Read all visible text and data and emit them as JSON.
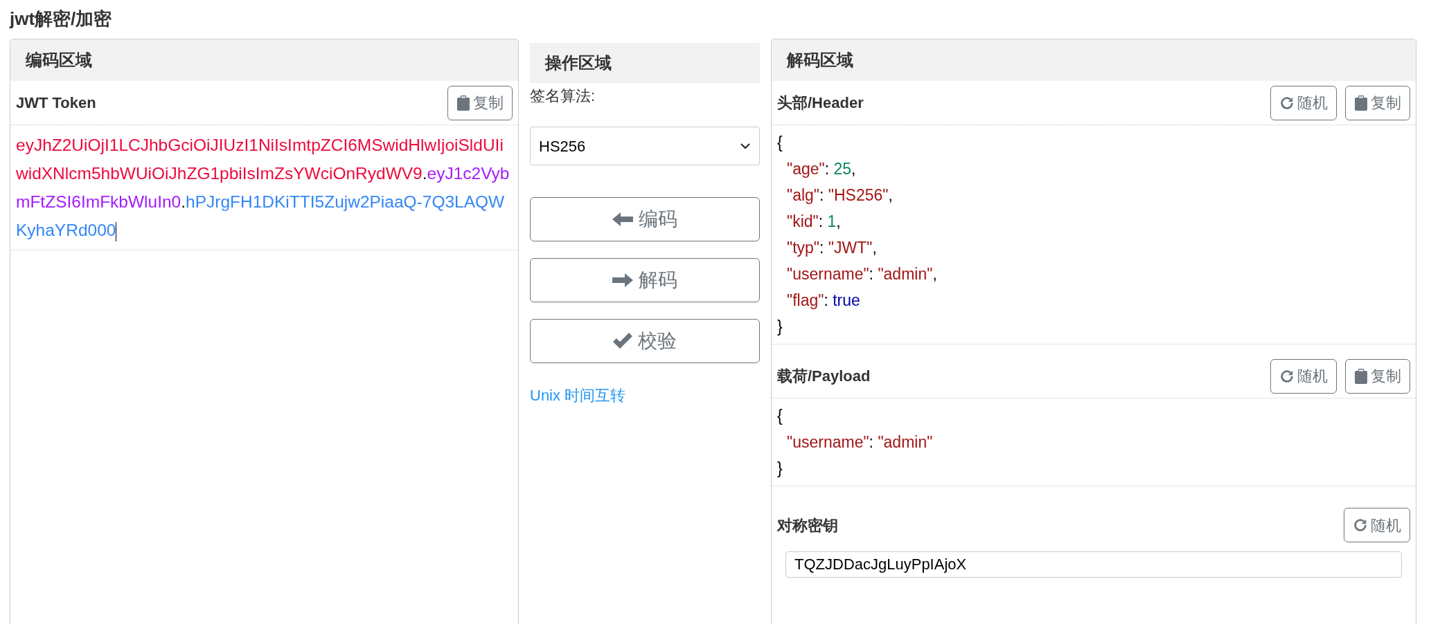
{
  "page_title": "jwt解密/加密",
  "encode_panel": {
    "title": "编码区域",
    "label": "JWT Token",
    "copy_button": "复制",
    "token_parts": [
      {
        "kind": "header",
        "text": "eyJhZ2UiOjI1LCJhbGciOiJIUzI1NiIsImtpZCI6MSwidHlwIjoiSldUIiwidXNlcm5hbWUiOiJhZG1pbiIsImZsYWciOnRydWV9",
        "color": "#ee0a3c"
      },
      {
        "kind": "dot",
        "text": "."
      },
      {
        "kind": "payload",
        "text": "eyJ1c2VybmFtZSI6ImFkbWluIn0",
        "color": "#a31aff"
      },
      {
        "kind": "dot",
        "text": "."
      },
      {
        "kind": "signature",
        "text": "hPJrgFH1DKiTTI5Zujw2PiaaQ-7Q3LAQWKyhaYRd000",
        "color": "#3287f5"
      }
    ]
  },
  "operate_panel": {
    "title": "操作区域",
    "algorithm_label": "签名算法:",
    "algorithm_value": "HS256",
    "buttons": [
      {
        "kind": "encode",
        "label": "编码"
      },
      {
        "kind": "decode",
        "label": "解码"
      },
      {
        "kind": "verify",
        "label": "校验"
      }
    ],
    "link": "Unix 时间互转"
  },
  "decode_panel": {
    "title": "解码区域",
    "header": {
      "label": "头部/Header",
      "random_button": "随机",
      "copy_button": "复制",
      "lines": [
        {
          "kind": "brace",
          "text": "{"
        },
        {
          "kind": "number",
          "key": "\"age\"",
          "colon": ":",
          "value": "25",
          "comma": ","
        },
        {
          "kind": "string",
          "key": "\"alg\"",
          "colon": ":",
          "value": "\"HS256\"",
          "comma": ","
        },
        {
          "kind": "number",
          "key": "\"kid\"",
          "colon": ":",
          "value": "1",
          "comma": ","
        },
        {
          "kind": "string",
          "key": "\"typ\"",
          "colon": ":",
          "value": "\"JWT\"",
          "comma": ","
        },
        {
          "kind": "string",
          "key": "\"username\"",
          "colon": ":",
          "value": "\"admin\"",
          "comma": ","
        },
        {
          "kind": "boolean",
          "key": "\"flag\"",
          "colon": ":",
          "value": "true"
        },
        {
          "kind": "brace",
          "text": "}"
        }
      ]
    },
    "payload": {
      "label": "载荷/Payload",
      "random_button": "随机",
      "copy_button": "复制",
      "lines": [
        {
          "kind": "brace",
          "text": "{"
        },
        {
          "kind": "string",
          "key": "\"username\"",
          "colon": ":",
          "value": "\"admin\""
        },
        {
          "kind": "brace",
          "text": "}"
        }
      ]
    },
    "secret": {
      "label": "对称密钥",
      "random_button": "随机",
      "value": "TQZJDDacJgLuyPpIAjoX"
    }
  }
}
